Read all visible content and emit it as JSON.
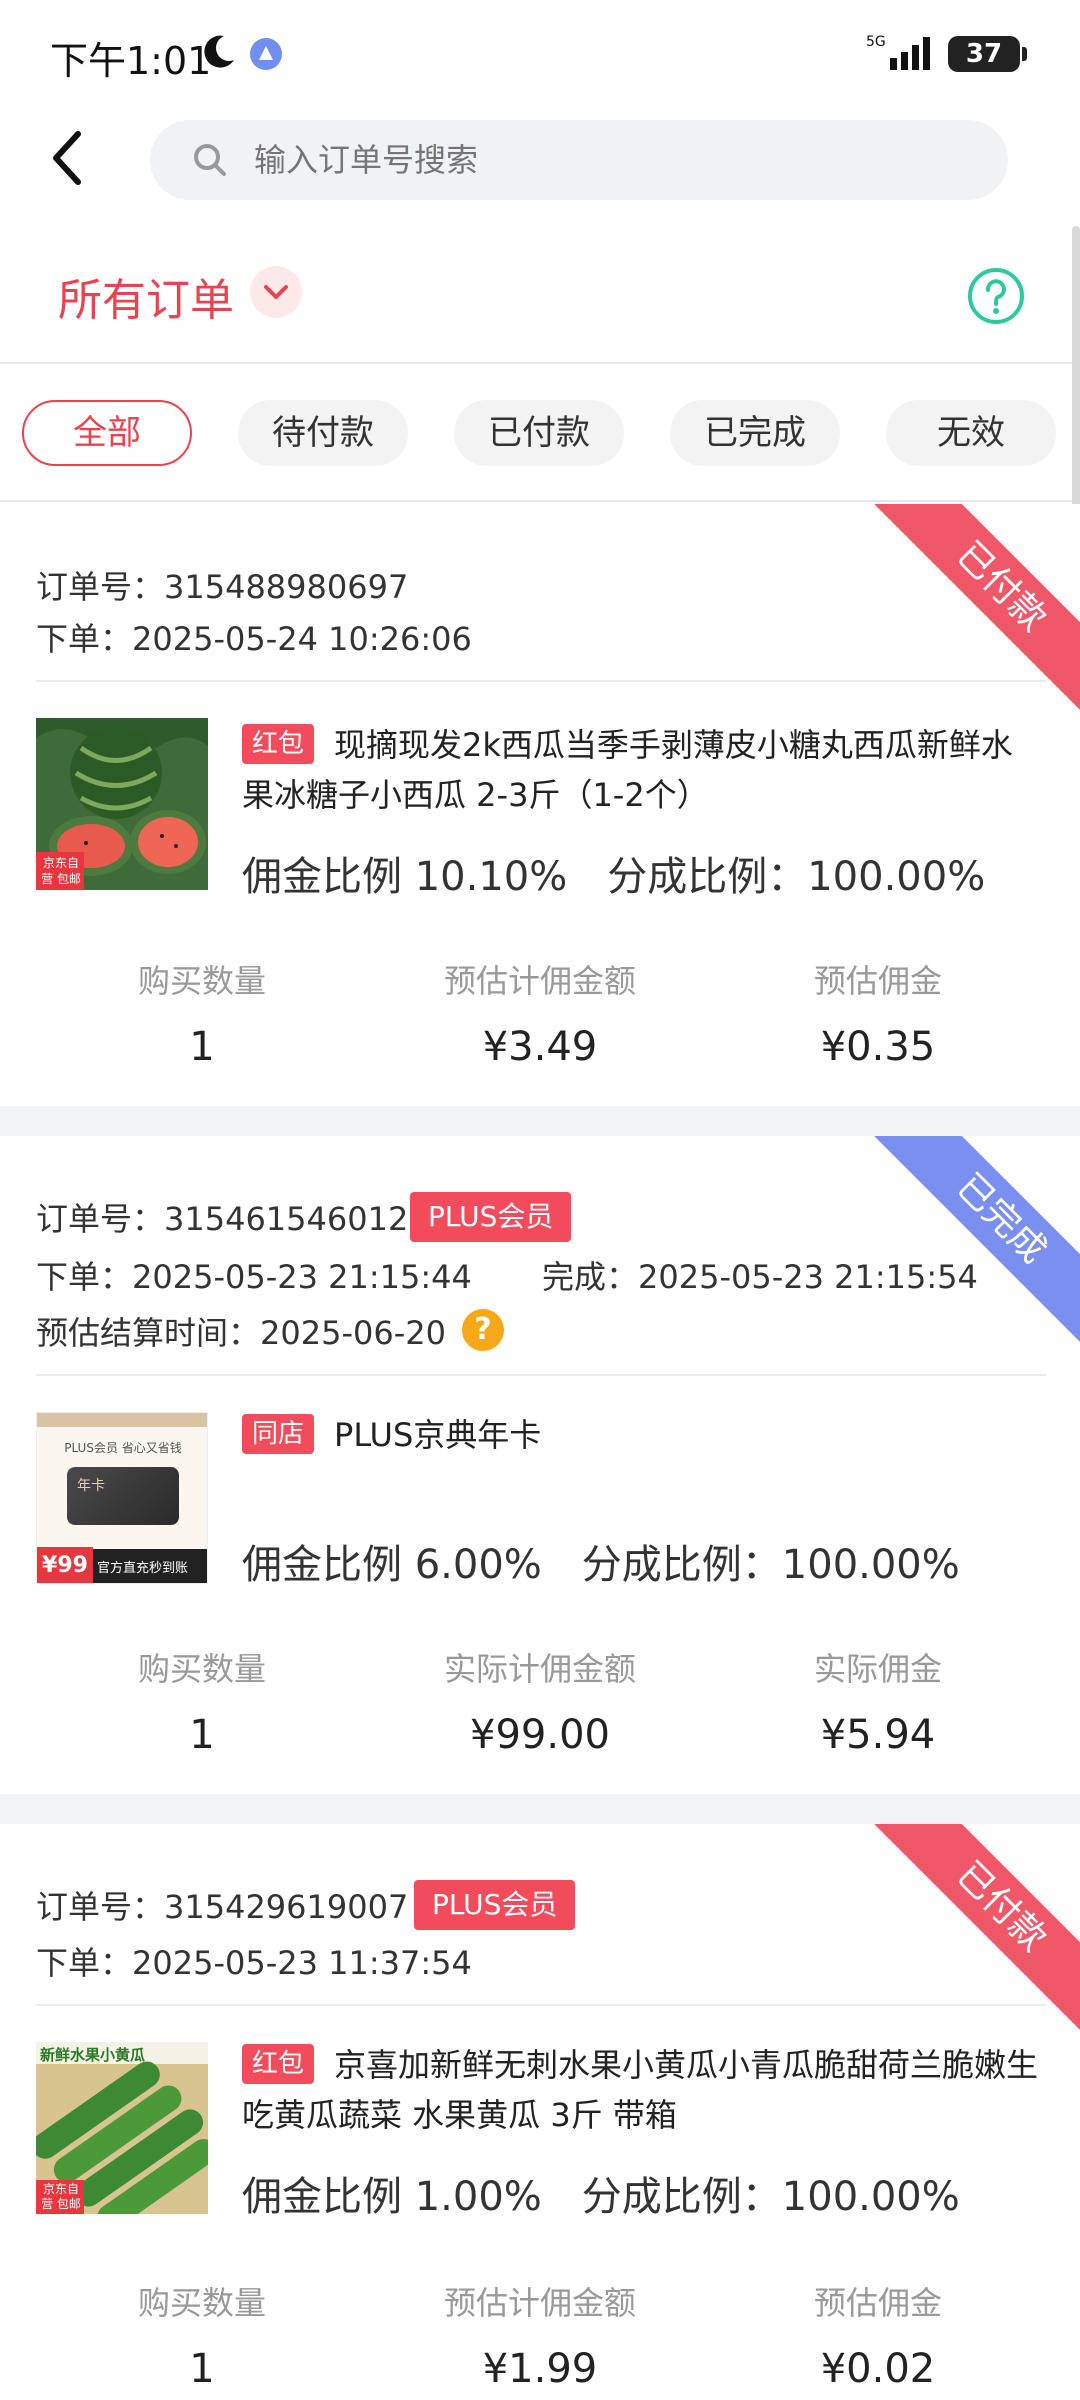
{
  "status_bar": {
    "time": "下午1:01",
    "network": "5G",
    "battery": "37"
  },
  "header": {
    "search_placeholder": "输入订单号搜索"
  },
  "filter": {
    "title": "所有订单"
  },
  "tabs": [
    {
      "label": "全部",
      "active": true
    },
    {
      "label": "待付款",
      "active": false
    },
    {
      "label": "已付款",
      "active": false
    },
    {
      "label": "已完成",
      "active": false
    },
    {
      "label": "无效",
      "active": false
    }
  ],
  "orders": [
    {
      "status": "已付款",
      "order_no": "订单号：315488980697",
      "placed": "下单：2025-05-24 10:26:06",
      "tag": "红包",
      "product_title": "现摘现发2k西瓜当季手剥薄皮小糖丸西瓜新鲜水果冰糖子小西瓜 2-3斤（1-2个）",
      "commission_ratio": "佣金比例 10.10%",
      "share_ratio": "分成比例：100.00%",
      "stats": [
        {
          "label": "购买数量",
          "value": "1"
        },
        {
          "label": "预估计佣金额",
          "value": "¥3.49"
        },
        {
          "label": "预估佣金",
          "value": "¥0.35"
        }
      ],
      "thumb_text": "京东自营 包邮"
    },
    {
      "status": "已完成",
      "order_no": "订单号：315461546012",
      "badge": "PLUS会员",
      "placed": "下单：2025-05-23 21:15:44",
      "completed": "完成：2025-05-23 21:15:54",
      "settle": "预估结算时间：2025-06-20",
      "tag": "同店",
      "product_title": "PLUS京典年卡",
      "commission_ratio": "佣金比例 6.00%",
      "share_ratio": "分成比例：100.00%",
      "stats": [
        {
          "label": "购买数量",
          "value": "1"
        },
        {
          "label": "实际计佣金额",
          "value": "¥99.00"
        },
        {
          "label": "实际佣金",
          "value": "¥5.94"
        }
      ],
      "thumb_text": "PLUS会员 省心又省钱",
      "thumb_card": "年卡",
      "thumb_price": "¥99",
      "thumb_foot": "官方直充秒到账"
    },
    {
      "status": "已付款",
      "order_no": "订单号：315429619007",
      "badge": "PLUS会员",
      "placed": "下单：2025-05-23 11:37:54",
      "tag": "红包",
      "product_title": "京喜加新鲜无刺水果小黄瓜小青瓜脆甜荷兰脆嫩生吃黄瓜蔬菜 水果黄瓜 3斤 带箱",
      "commission_ratio": "佣金比例 1.00%",
      "share_ratio": "分成比例：100.00%",
      "stats": [
        {
          "label": "购买数量",
          "value": "1"
        },
        {
          "label": "预估计佣金额",
          "value": "¥1.99"
        },
        {
          "label": "预估佣金",
          "value": "¥0.02"
        }
      ],
      "thumb_text": "新鲜水果小黄瓜",
      "thumb_foot": "京东自营 包邮"
    }
  ],
  "colors": {
    "accent": "#e94350",
    "paid_ribbon": "#f0586a",
    "done_ribbon": "#7b8ff0",
    "help": "#2cc9a0",
    "question": "#f6a816"
  }
}
